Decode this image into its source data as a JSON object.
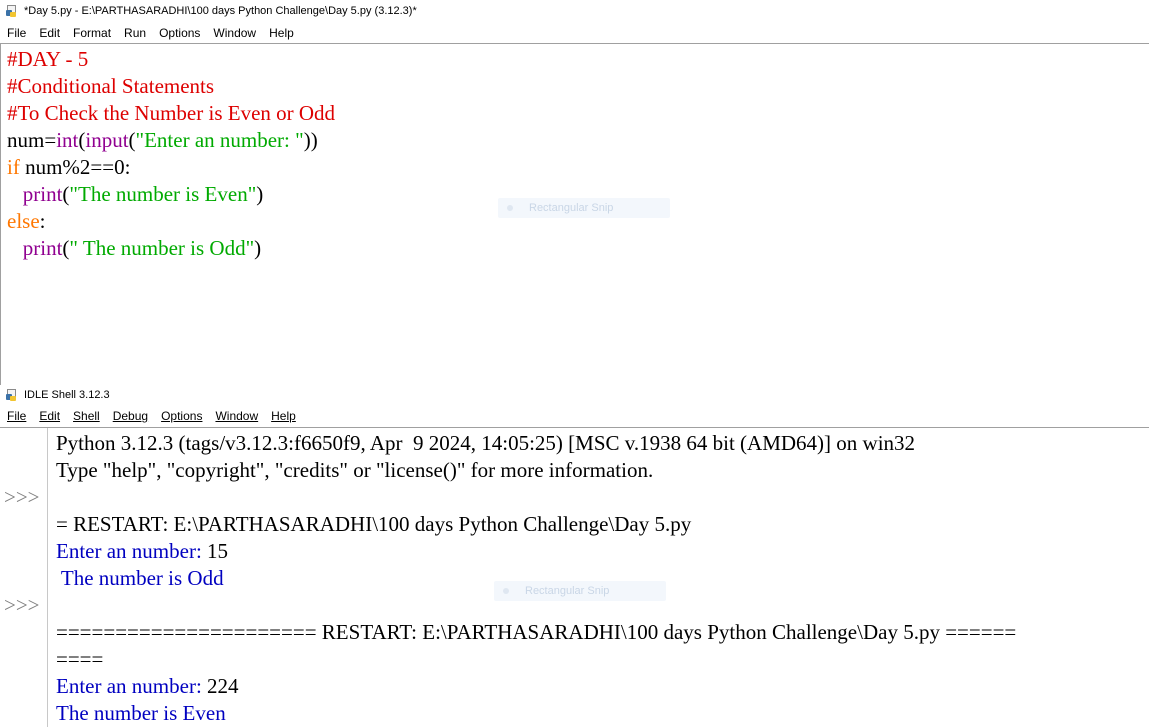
{
  "editor": {
    "title": "*Day 5.py - E:\\PARTHASARADHI\\100 days Python Challenge\\Day 5.py (3.12.3)*",
    "menu": [
      "File",
      "Edit",
      "Format",
      "Run",
      "Options",
      "Window",
      "Help"
    ],
    "code": [
      [
        {
          "t": "#DAY - 5",
          "c": "comment"
        }
      ],
      [
        {
          "t": "#Conditional Statements",
          "c": "comment"
        }
      ],
      [
        {
          "t": "#To Check the Number is Even or Odd",
          "c": "comment"
        }
      ],
      [
        {
          "t": "num=",
          "c": "default"
        },
        {
          "t": "int",
          "c": "builtin"
        },
        {
          "t": "(",
          "c": "default"
        },
        {
          "t": "input",
          "c": "builtin"
        },
        {
          "t": "(",
          "c": "default"
        },
        {
          "t": "\"Enter an number: \"",
          "c": "string"
        },
        {
          "t": "))",
          "c": "default"
        }
      ],
      [
        {
          "t": "if",
          "c": "keyword"
        },
        {
          "t": " num%2==0:",
          "c": "default"
        }
      ],
      [
        {
          "t": "   ",
          "c": "default"
        },
        {
          "t": "print",
          "c": "builtin"
        },
        {
          "t": "(",
          "c": "default"
        },
        {
          "t": "\"The number is Even\"",
          "c": "string"
        },
        {
          "t": ")",
          "c": "default"
        }
      ],
      [
        {
          "t": "else",
          "c": "keyword"
        },
        {
          "t": ":",
          "c": "default"
        }
      ],
      [
        {
          "t": "   ",
          "c": "default"
        },
        {
          "t": "print",
          "c": "builtin"
        },
        {
          "t": "(",
          "c": "default"
        },
        {
          "t": "\" The number is Odd\"",
          "c": "string"
        },
        {
          "t": ")",
          "c": "default"
        }
      ]
    ],
    "snip_label": "Rectangular Snip"
  },
  "shell": {
    "title": "IDLE Shell 3.12.3",
    "menu": [
      "File",
      "Edit",
      "Shell",
      "Debug",
      "Options",
      "Window",
      "Help"
    ],
    "prompt": ">>>",
    "lines": [
      [
        {
          "t": "Python 3.12.3 (tags/v3.12.3:f6650f9, Apr  9 2024, 14:05:25) [MSC v.1938 64 bit (AMD64)] on win32",
          "c": "default"
        }
      ],
      [
        {
          "t": "Type \"help\", \"copyright\", \"credits\" or \"license()\" for more information.",
          "c": "default"
        }
      ],
      [],
      [
        {
          "t": "= RESTART: E:\\PARTHASARADHI\\100 days Python Challenge\\Day 5.py",
          "c": "default"
        }
      ],
      [
        {
          "t": "Enter an number: ",
          "c": "stdout"
        },
        {
          "t": "15",
          "c": "default"
        }
      ],
      [
        {
          "t": " The number is Odd",
          "c": "stdout"
        }
      ],
      [],
      [
        {
          "t": "====================== RESTART: E:\\PARTHASARADHI\\100 days Python Challenge\\Day 5.py ======",
          "c": "default"
        }
      ],
      [
        {
          "t": "====",
          "c": "default"
        }
      ],
      [
        {
          "t": "Enter an number: ",
          "c": "stdout"
        },
        {
          "t": "224",
          "c": "default"
        }
      ],
      [
        {
          "t": "The number is Even",
          "c": "stdout"
        }
      ]
    ],
    "snip_label": "Rectangular Snip"
  }
}
